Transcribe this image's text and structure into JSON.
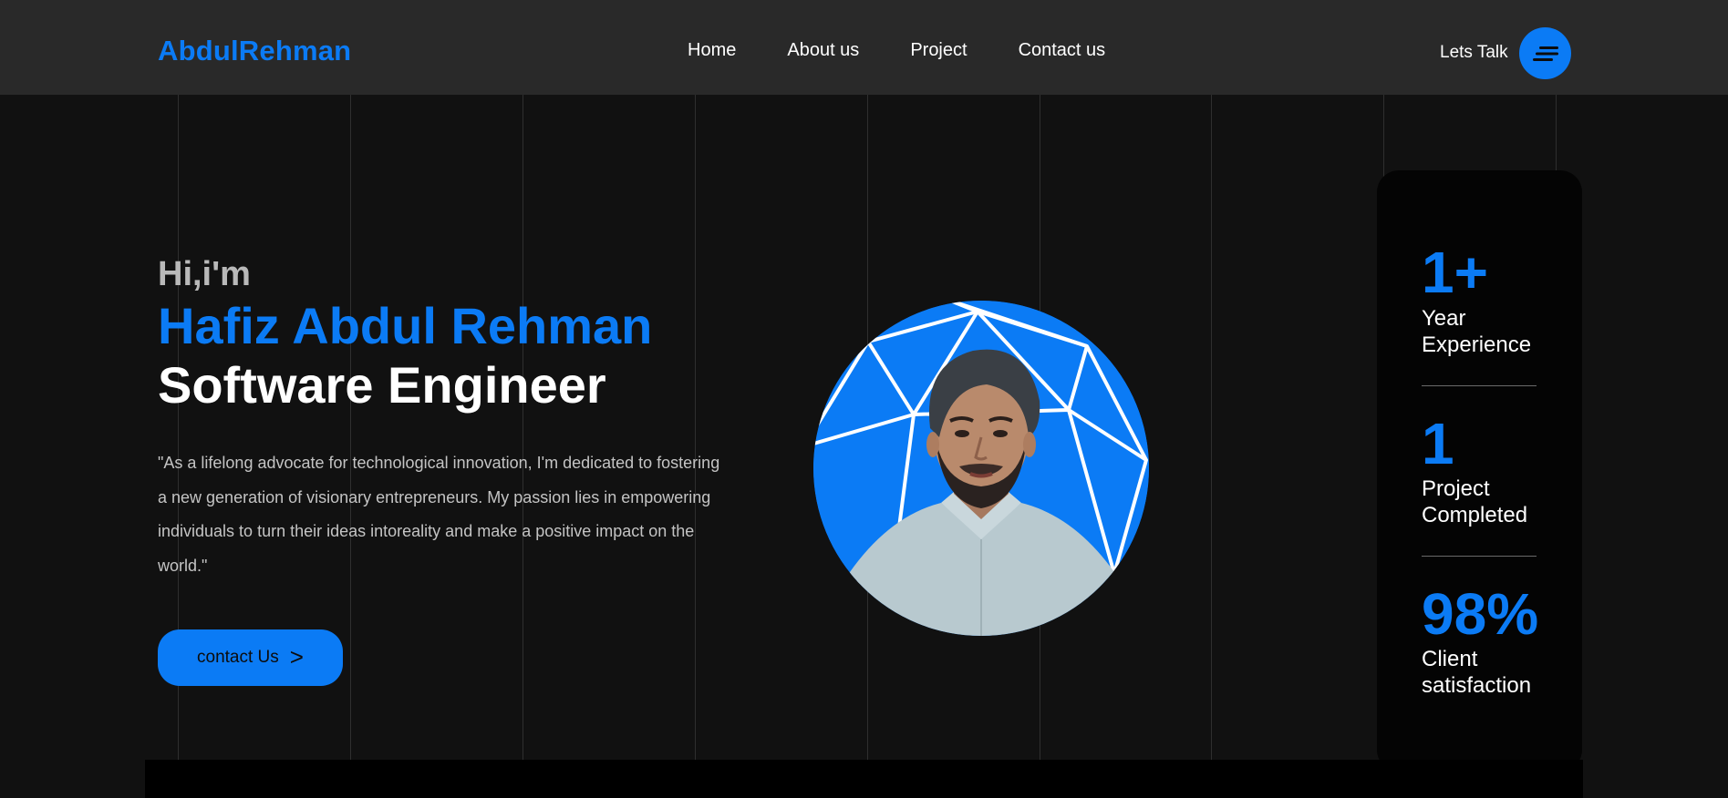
{
  "header": {
    "logo": "AbdulRehman",
    "nav": [
      "Home",
      "About us",
      "Project",
      "Contact us"
    ],
    "lets_talk": "Lets Talk",
    "menu_icon": "menu-icon"
  },
  "hero": {
    "greeting": "Hi,i'm",
    "name": "Hafiz Abdul Rehman",
    "role": "Software Engineer",
    "bio": "\"As a lifelong advocate for technological innovation, I'm dedicated to fostering a new generation of visionary entrepreneurs. My passion lies in empowering individuals to turn their ideas intoreality and make a positive impact on the world.\"",
    "cta_label": "contact Us",
    "cta_icon": ">"
  },
  "stats": [
    {
      "value": "1+",
      "label_line1": "Year",
      "label_line2": "Experience"
    },
    {
      "value": "1",
      "label_line1": "Project",
      "label_line2": "Completed"
    },
    {
      "value": "98%",
      "label_line1": "Client",
      "label_line2": "satisfaction"
    }
  ],
  "colors": {
    "accent": "#0b7bf5",
    "background": "#111111",
    "header": "#292929",
    "card": "#040404"
  }
}
